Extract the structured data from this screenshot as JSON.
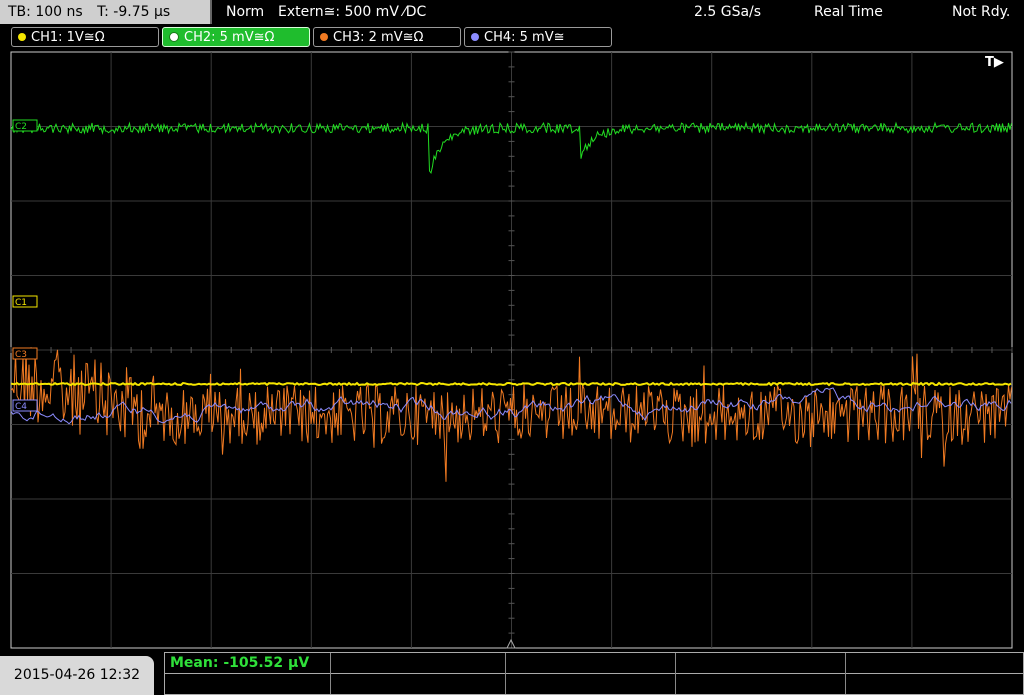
{
  "topbar": {
    "timebase": "TB: 100 ns",
    "trigger_pos": "T: -9.75 µs",
    "acq_mode": "Norm",
    "trigger_source": "Extern≅: 500 mV ⁄DC",
    "sample_rate": "2.5 GSa/s",
    "display_mode": "Real Time",
    "status": "Not Rdy."
  },
  "channels": [
    {
      "id": "CH1",
      "label": "CH1: 1V≅Ω",
      "color": "#f5e600",
      "marker": "C1"
    },
    {
      "id": "CH2",
      "label": "CH2: 5 mV≅Ω",
      "color": "#22dd22",
      "marker": "C2",
      "active": true
    },
    {
      "id": "CH3",
      "label": "CH3: 2 mV≅Ω",
      "color": "#f07a22",
      "marker": "C3"
    },
    {
      "id": "CH4",
      "label": "CH4: 5 mV≅",
      "color": "#8c8cff",
      "marker": "C4"
    }
  ],
  "trigger_indicator": "T▶",
  "bottom": {
    "datetime": "2015-04-26 12:32",
    "measurement": "Mean: -105.52 µV"
  },
  "colors": {
    "grid": "#3a3a3a",
    "ch1": "#f5e600",
    "ch2": "#22dd22",
    "ch3": "#f07a22",
    "ch4": "#8c8cff",
    "frame": "#cccccc"
  }
}
